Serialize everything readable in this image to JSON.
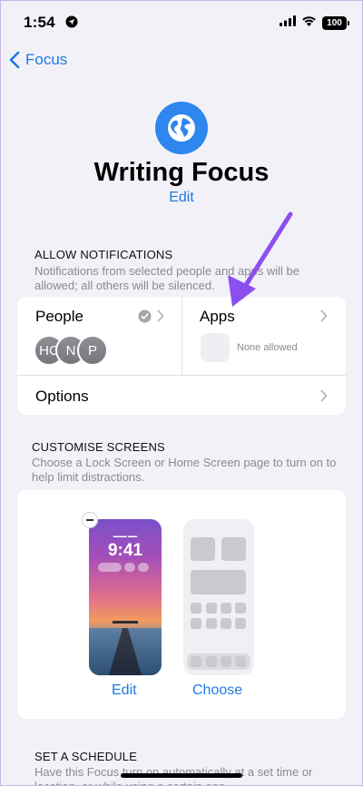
{
  "status_bar": {
    "time": "1:54",
    "battery": "100"
  },
  "nav": {
    "back_label": "Focus"
  },
  "focus": {
    "title": "Writing Focus",
    "edit_label": "Edit",
    "accent": "#2e86ef"
  },
  "allow_notifications": {
    "header": "ALLOW NOTIFICATIONS",
    "description": "Notifications from selected people and apps will be allowed; all others will be silenced.",
    "people_label": "People",
    "avatars": [
      "HC",
      "N",
      "P"
    ],
    "apps_label": "Apps",
    "apps_status": "None allowed",
    "options_label": "Options"
  },
  "customise_screens": {
    "header": "CUSTOMISE SCREENS",
    "description": "Choose a Lock Screen or Home Screen page to turn on to help limit distractions.",
    "lock_time": "9:41",
    "lock_edit_label": "Edit",
    "home_choose_label": "Choose"
  },
  "schedule": {
    "header": "SET A SCHEDULE",
    "description": "Have this Focus turn on automatically at a set time or location, or while using a certain app."
  },
  "annotation": {
    "arrow_color": "#8b4ff0"
  },
  "colors": {
    "link": "#1f7ae0",
    "background": "#f2f1f7"
  }
}
